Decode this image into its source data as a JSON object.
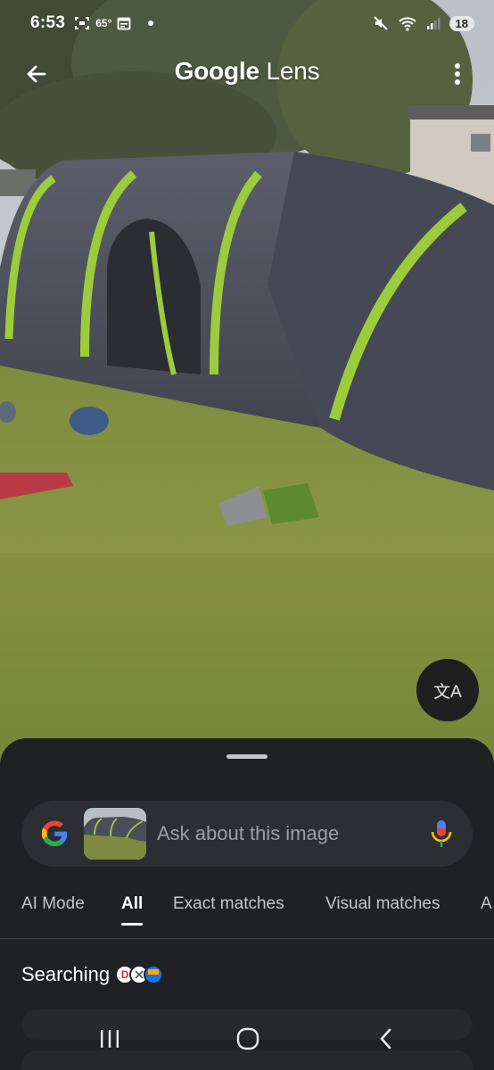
{
  "status_bar": {
    "time": "6:53",
    "temperature": "65°",
    "battery": "18",
    "icons": [
      "screenshot-icon",
      "calendar-icon",
      "dot-icon",
      "mute-icon",
      "wifi-icon",
      "signal-icon"
    ]
  },
  "top_bar": {
    "title_brand": "Google",
    "title_product": "Lens",
    "back_icon": "arrow-back-icon",
    "menu_icon": "more-vert-icon"
  },
  "translate_button": {
    "icon": "translate-icon",
    "glyph": "文A"
  },
  "sheet": {
    "search": {
      "placeholder": "Ask about this image"
    },
    "tabs": [
      {
        "label": "AI Mode",
        "active": false
      },
      {
        "label": "All",
        "active": true
      },
      {
        "label": "Exact matches",
        "active": false
      },
      {
        "label": "Visual matches",
        "active": false
      },
      {
        "label": "A",
        "active": false
      }
    ],
    "status": {
      "label": "Searching"
    },
    "favicons": [
      {
        "letter": "D",
        "color": "#d93025"
      },
      {
        "letter": "",
        "color": "#ffffff"
      },
      {
        "letter": "",
        "color": "#f9ab00"
      }
    ]
  },
  "nav_bar": {
    "buttons": [
      "recent-apps-icon",
      "home-icon",
      "back-icon"
    ]
  },
  "colors": {
    "sheet_bg": "#1f2125",
    "pill_bg": "#2c2e33",
    "accent_green": "#9ccc3c",
    "tent_grey": "#4a4e59"
  }
}
